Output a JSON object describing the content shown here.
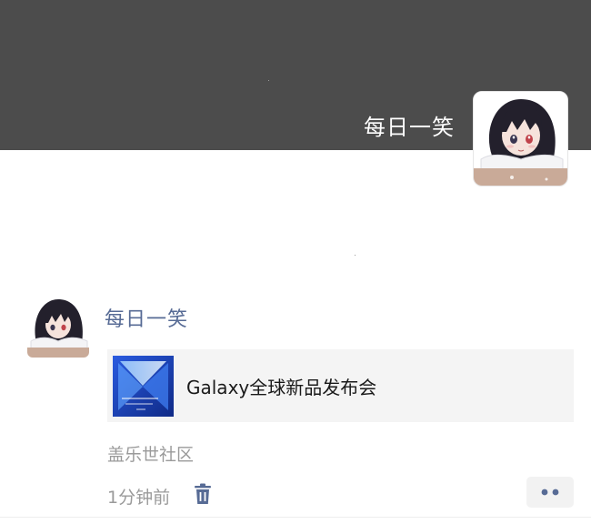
{
  "cover": {
    "username": "每日一笑",
    "avatar_alt": "anime-girl-avatar"
  },
  "post": {
    "author": "每日一笑",
    "link": {
      "title": "Galaxy全球新品发布会",
      "thumbnail": "galaxy-event-thumbnail"
    },
    "source": "盖乐世社区",
    "time": "1分钟前"
  },
  "colors": {
    "cover_bg": "#4c4c4c",
    "author_name": "#576b95",
    "link_card_bg": "#f4f4f4",
    "meta_text": "#9a9a9a",
    "thumb_blue": "#1e3fa6"
  },
  "icons": {
    "delete": "trash-icon",
    "more": "more-dots-icon"
  }
}
